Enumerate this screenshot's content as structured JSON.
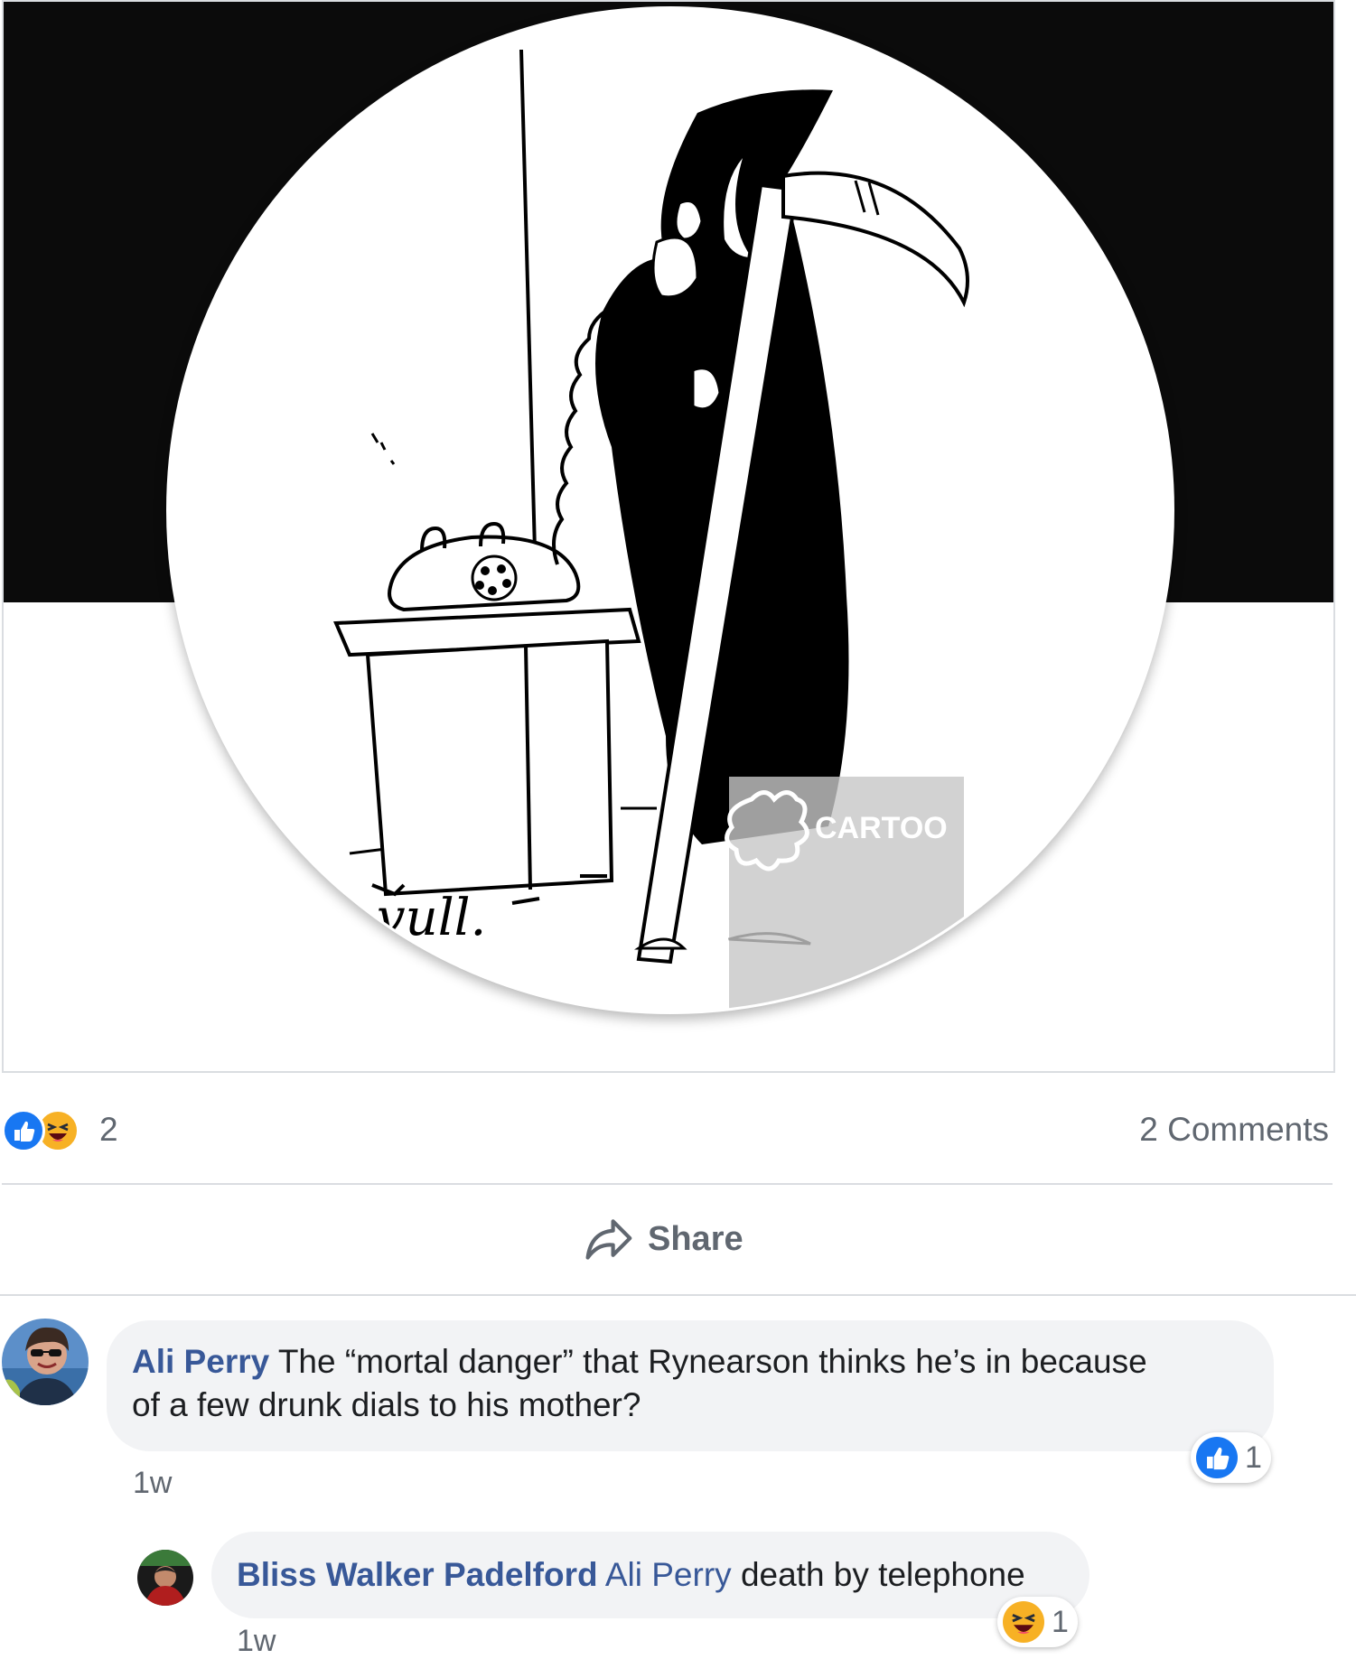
{
  "post": {
    "image": {
      "watermark_text": "CARTOO",
      "signature_text": "vull."
    },
    "stats": {
      "reaction_count": "2",
      "reaction_types": [
        "like-icon",
        "haha-icon"
      ],
      "comments_label": "2 Comments"
    },
    "actions": {
      "share_label": "Share"
    }
  },
  "comments": [
    {
      "author": "Ali Perry",
      "text": "The “mortal danger” that Rynearson thinks he’s in because",
      "text_line2": "of a few drunk dials to his mother?",
      "time": "1w",
      "reaction_icon": "like-icon",
      "reaction_count": "1"
    },
    {
      "author": "Bliss Walker Padelford",
      "mention": "Ali Perry",
      "text": "death by telephone",
      "time": "1w",
      "reaction_icon": "haha-icon",
      "reaction_count": "1"
    }
  ],
  "colors": {
    "link_blue": "#385898",
    "like_blue": "#1877f2",
    "haha_yellow": "#f7b125",
    "bubble_bg": "#f2f3f5",
    "meta_gray": "#606770"
  }
}
